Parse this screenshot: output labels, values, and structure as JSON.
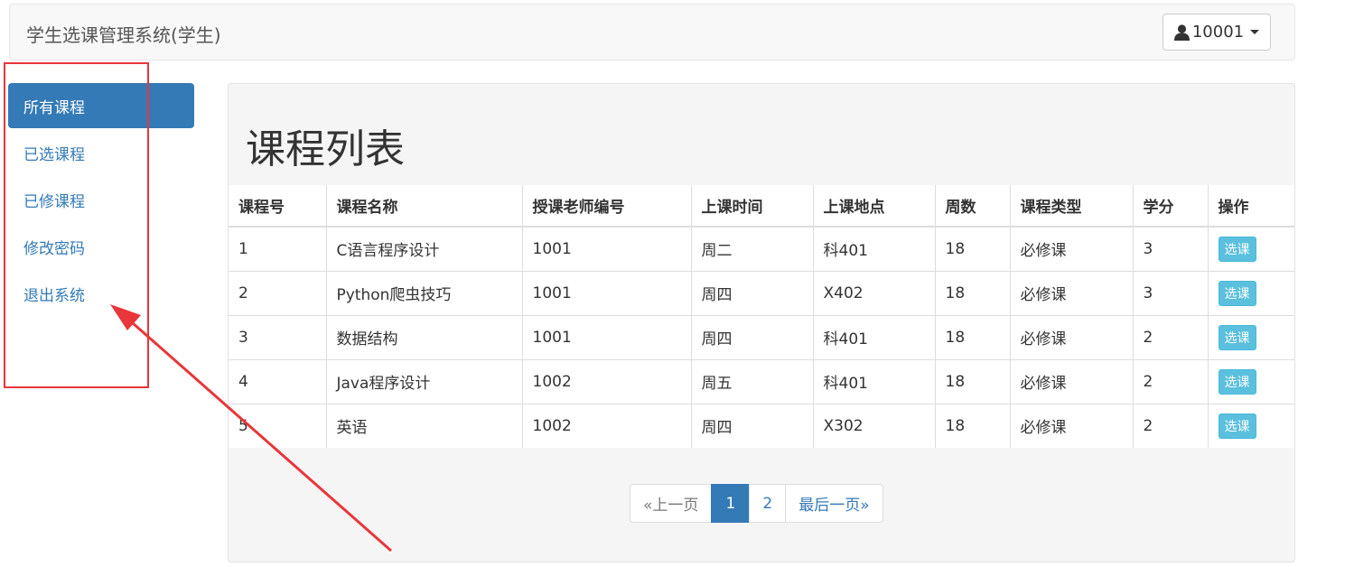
{
  "navbar": {
    "brand": "学生选课管理系统(学生)",
    "user": "10001"
  },
  "sidebar": {
    "items": [
      {
        "label": "所有课程",
        "active": true
      },
      {
        "label": "已选课程"
      },
      {
        "label": "已修课程"
      },
      {
        "label": "修改密码"
      },
      {
        "label": "退出系统"
      }
    ]
  },
  "panel": {
    "title": "课程列表"
  },
  "table": {
    "headers": [
      "课程号",
      "课程名称",
      "授课老师编号",
      "上课时间",
      "上课地点",
      "周数",
      "课程类型",
      "学分",
      "操作"
    ],
    "rows": [
      [
        "1",
        "C语言程序设计",
        "1001",
        "周二",
        "科401",
        "18",
        "必修课",
        "3",
        "选课"
      ],
      [
        "2",
        "Python爬虫技巧",
        "1001",
        "周四",
        "X402",
        "18",
        "必修课",
        "3",
        "选课"
      ],
      [
        "3",
        "数据结构",
        "1001",
        "周四",
        "科401",
        "18",
        "必修课",
        "2",
        "选课"
      ],
      [
        "4",
        "Java程序设计",
        "1002",
        "周五",
        "科401",
        "18",
        "必修课",
        "2",
        "选课"
      ],
      [
        "5",
        "英语",
        "1002",
        "周四",
        "X302",
        "18",
        "必修课",
        "2",
        "选课"
      ]
    ]
  },
  "pagination": {
    "prev": "«上一页",
    "pages": [
      "1",
      "2"
    ],
    "current": "1",
    "last": "最后一页»"
  },
  "colors": {
    "primary": "#337ab7",
    "info": "#5bc0de",
    "annotation": "#e8363a"
  },
  "icons": {
    "user": "user-icon",
    "caret": "caret-down-icon"
  }
}
